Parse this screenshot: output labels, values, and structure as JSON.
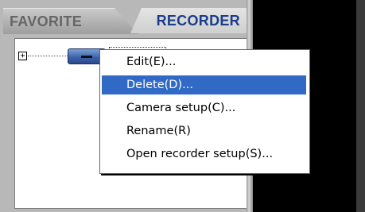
{
  "tabs": {
    "favorite": "FAVORITE",
    "recorder": "RECORDER"
  },
  "tree": {
    "expand_glyph": "+"
  },
  "context_menu": {
    "items": [
      {
        "label": "Edit(E)..."
      },
      {
        "label": "Delete(D)...",
        "selected": true
      },
      {
        "label": "Camera setup(C)..."
      },
      {
        "label": "Rename(R)"
      },
      {
        "label": "Open recorder setup(S)..."
      }
    ]
  },
  "colors": {
    "selection": "#316ac5",
    "recorder_tab_text": "#1c3d8a"
  }
}
